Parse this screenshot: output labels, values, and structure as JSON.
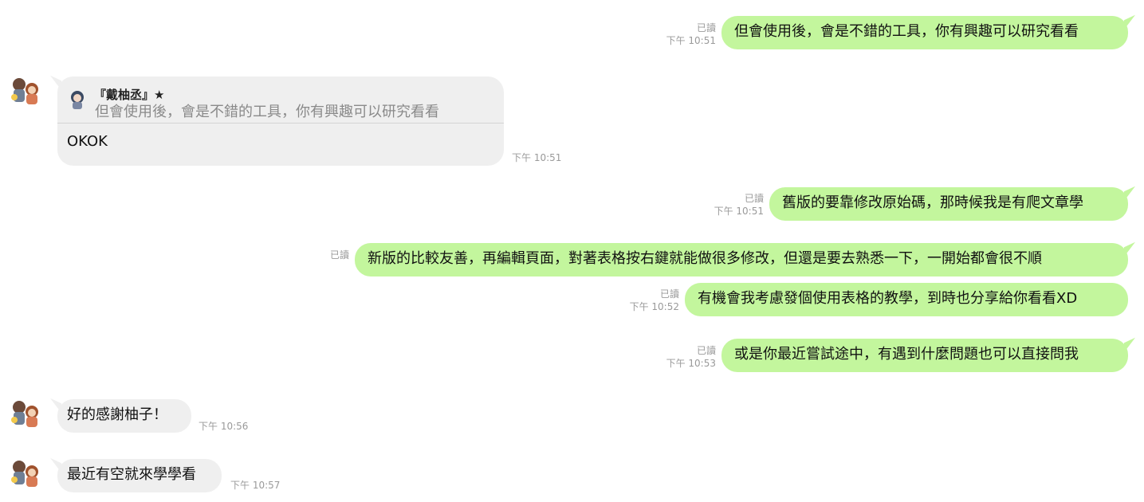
{
  "messages": [
    {
      "id": "m1",
      "side": "out",
      "text": "但會使用後，會是不錯的工具，你有興趣可以研究看看",
      "read": "已讀",
      "time": "下午 10:51"
    },
    {
      "id": "m2",
      "side": "in",
      "reply_to": {
        "name": "『戴柚丞』★",
        "quote": "但會使用後，會是不錯的工具，你有興趣可以研究看看"
      },
      "text": "OKOK",
      "time": "下午 10:51"
    },
    {
      "id": "m3",
      "side": "out",
      "text": "舊版的要靠修改原始碼，那時候我是有爬文章學",
      "read": "已讀",
      "time": "下午 10:51"
    },
    {
      "id": "m4",
      "side": "out",
      "text": "新版的比較友善，再編輯頁面，對著表格按右鍵就能做很多修改，但還是要去熟悉一下，一開始都會很不順",
      "read": "已讀"
    },
    {
      "id": "m5",
      "side": "out",
      "text": "有機會我考慮發個使用表格的教學，到時也分享給你看看XD",
      "read": "已讀",
      "time": "下午 10:52"
    },
    {
      "id": "m6",
      "side": "out",
      "text": "或是你最近嘗試途中，有遇到什麼問題也可以直接問我",
      "read": "已讀",
      "time": "下午 10:53"
    },
    {
      "id": "m7",
      "side": "in",
      "text": "好的感謝柚子！",
      "time": "下午 10:56"
    },
    {
      "id": "m8",
      "side": "in",
      "text": "最近有空就來學學看",
      "time": "下午 10:57"
    }
  ],
  "colors": {
    "outgoing_bubble": "#c3f69d",
    "incoming_bubble": "#efefef",
    "meta_text": "#9a9a9a"
  },
  "icons": {
    "contact_avatar": "avatar-icon",
    "reply_avatar": "avatar-icon"
  }
}
